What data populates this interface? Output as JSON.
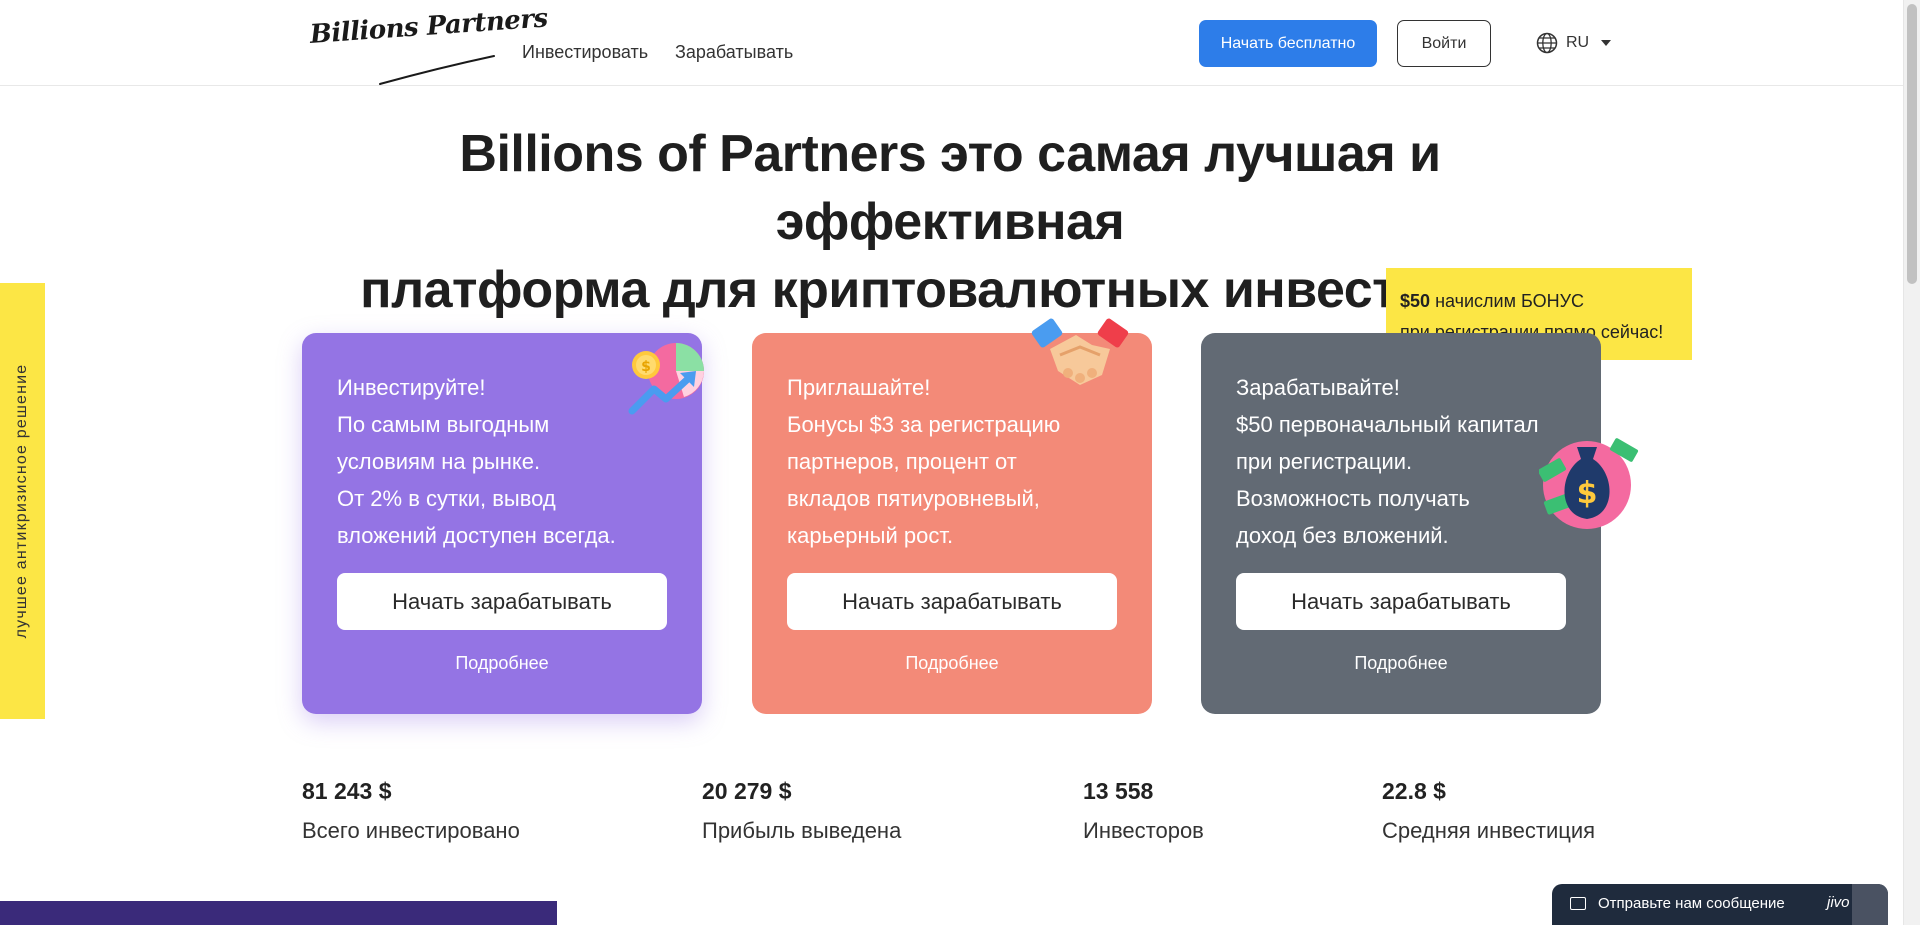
{
  "header": {
    "logo_text": "Billions Partners",
    "nav": [
      "Инвестировать",
      "Зарабатывать"
    ],
    "start_button": "Начать бесплатно",
    "login_button": "Войти",
    "language": "RU"
  },
  "headline": {
    "line1": "Billions of Partners это самая лучшая и эффективная",
    "line2": "платформа для криптовалютных инвестиций!"
  },
  "side_tab": "лучшее антикризисное решение",
  "bonus": {
    "amount": "$50",
    "line1_rest": "начислим БОНУС",
    "line2": "при регистрации прямо сейчас!"
  },
  "cards": [
    {
      "lines": [
        "Инвестируйте!",
        "По самым выгодным",
        "условиям на рынке.",
        "От 2% в сутки, вывод",
        "вложений доступен всегда."
      ],
      "button": "Начать зарабатывать",
      "more": "Подробнее",
      "icon": "chart-growth-icon",
      "color": "#9474e4"
    },
    {
      "lines": [
        "Приглашайте!",
        "Бонусы $3 за регистрацию",
        "партнеров, процент от",
        "вкладов пятиуровневый,",
        "карьерный рост."
      ],
      "button": "Начать зарабатывать",
      "more": "Подробнее",
      "icon": "handshake-icon",
      "color": "#f38a78"
    },
    {
      "lines": [
        "Зарабатывайте!",
        "$50 первоначальный капитал",
        "при регистрации.",
        "Возможность получать",
        "доход без вложений."
      ],
      "button": "Начать зарабатывать",
      "more": "Подробнее",
      "icon": "money-bag-icon",
      "color": "#626a74"
    }
  ],
  "stats": [
    {
      "value": "81 243 $",
      "label": "Всего инвестировано"
    },
    {
      "value": "20 279 $",
      "label": "Прибыль выведена"
    },
    {
      "value": "13 558",
      "label": "Инвесторов"
    },
    {
      "value": "22.8 $",
      "label": "Средняя инвестиция"
    }
  ],
  "chat": {
    "text": "Отправьте нам сообщение",
    "brand": "jivo"
  },
  "colors": {
    "accent_blue": "#2d7de9",
    "yellow": "#fce645",
    "purple": "#9474e4",
    "salmon": "#f38a78",
    "slate": "#626a74"
  }
}
